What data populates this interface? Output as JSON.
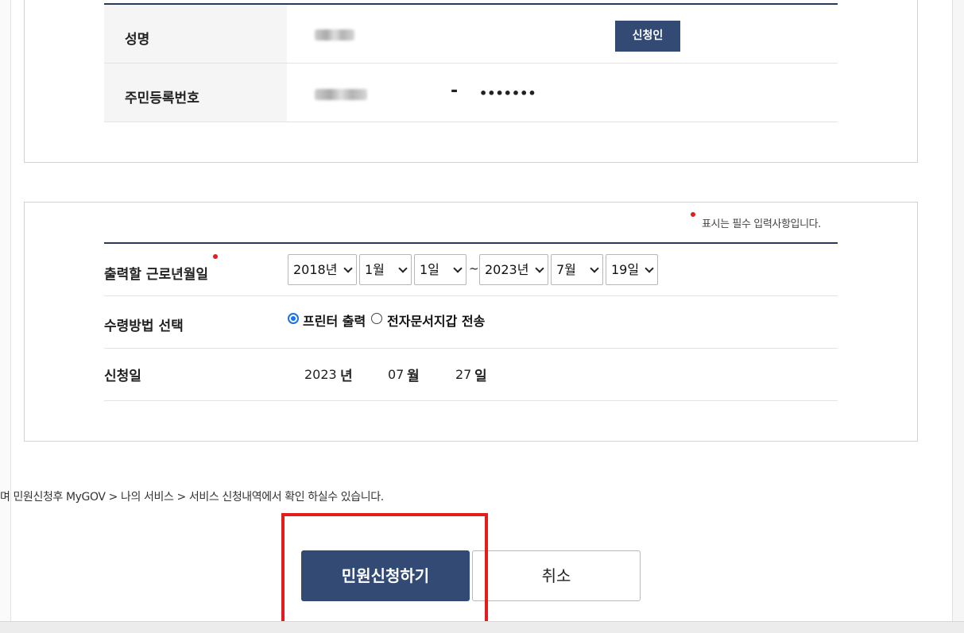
{
  "applicant": {
    "name_label": "성명",
    "apply_person_button": "신청인",
    "rrn_label": "주민등록번호",
    "rrn_dash": "-",
    "rrn_masked": "•••••••"
  },
  "form": {
    "required_note": "표시는 필수 입력사항입니다.",
    "period_label": "출력할 근로년월일",
    "from_year": "2018년",
    "from_month": "1월",
    "from_day": "1일",
    "range_sep": "~",
    "to_year": "2023년",
    "to_month": "7월",
    "to_day": "19일",
    "receive_label": "수령방법 선택",
    "receive_options": [
      "프린터 출력",
      "전자문서지갑 전송"
    ],
    "receive_selected": "프린터 출력",
    "apply_date_label": "신청일",
    "apply_year": "2023",
    "apply_year_unit": "년",
    "apply_month": "07",
    "apply_month_unit": "월",
    "apply_day": "27",
    "apply_day_unit": "일"
  },
  "notice": "며 민원신청후 MyGOV > 나의 서비스 > 서비스 신청내역에서 확인 하실수 있습니다.",
  "actions": {
    "submit": "민원신청하기",
    "cancel": "취소"
  },
  "colors": {
    "navy": "#334a75",
    "required_dot": "#e02020",
    "highlight_frame": "#e31c1c",
    "radio_selected": "#1a73e8"
  }
}
